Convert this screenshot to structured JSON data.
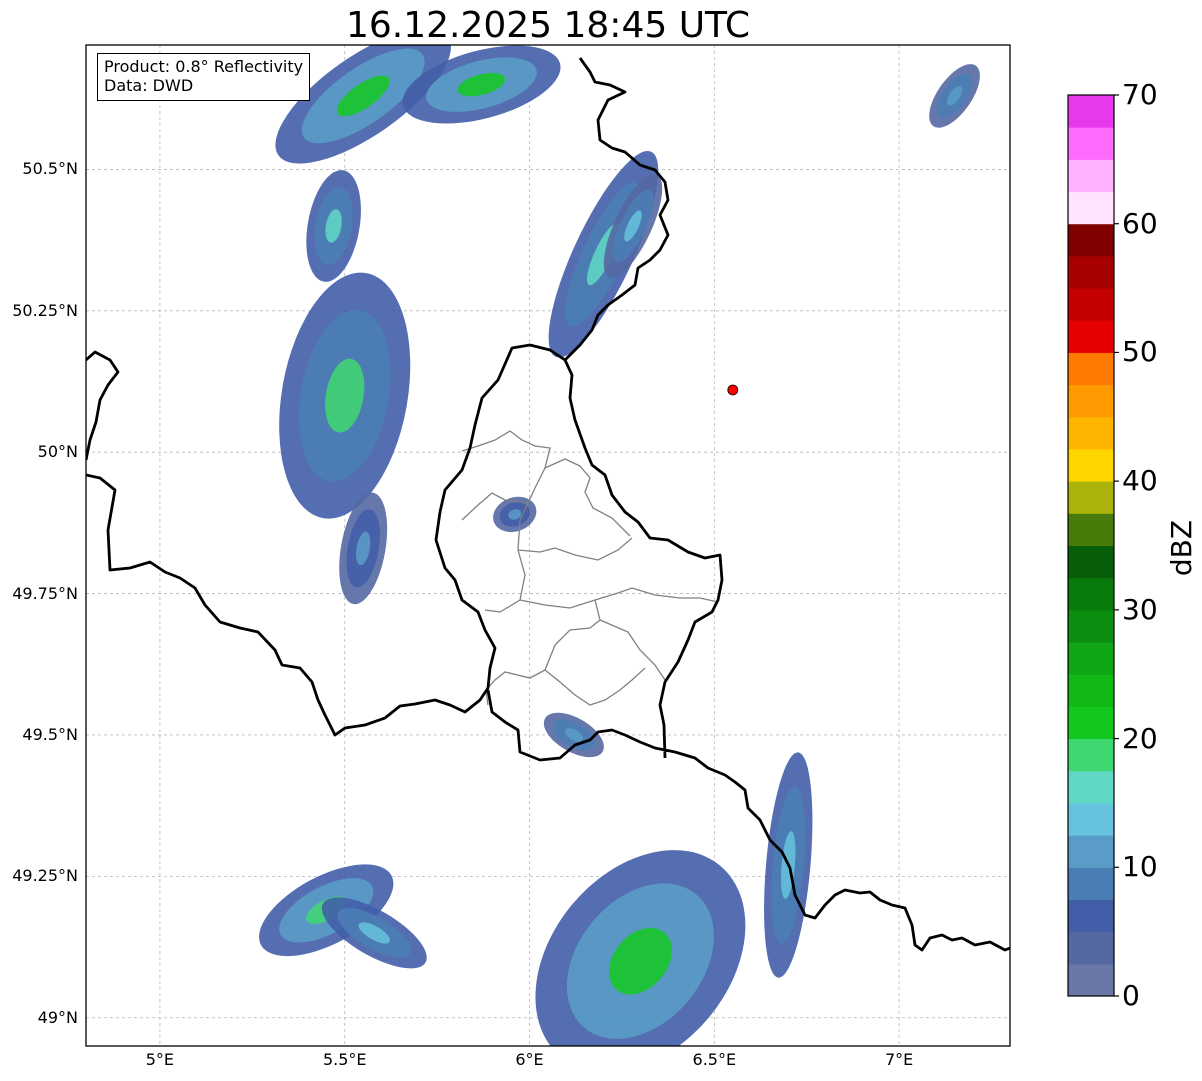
{
  "title": "16.12.2025 18:45 UTC",
  "legend": {
    "product": "Product: 0.8° Reflectivity",
    "source": "Data: DWD"
  },
  "map": {
    "lon_range": [
      4.8,
      7.3
    ],
    "lat_range": [
      48.95,
      50.72
    ],
    "lon_ticks": [
      {
        "value": 5.0,
        "label": "5°E"
      },
      {
        "value": 5.5,
        "label": "5.5°E"
      },
      {
        "value": 6.0,
        "label": "6°E"
      },
      {
        "value": 6.5,
        "label": "6.5°E"
      },
      {
        "value": 7.0,
        "label": "7°E"
      }
    ],
    "lat_ticks": [
      {
        "value": 49.0,
        "label": "49°N"
      },
      {
        "value": 49.25,
        "label": "49.25°N"
      },
      {
        "value": 49.5,
        "label": "49.5°N"
      },
      {
        "value": 49.75,
        "label": "49.75°N"
      },
      {
        "value": 50.0,
        "label": "50°N"
      },
      {
        "value": 50.25,
        "label": "50.25°N"
      },
      {
        "value": 50.5,
        "label": "50.5°N"
      }
    ],
    "gridlines": true,
    "marker": {
      "lon": 6.55,
      "lat": 50.11,
      "color": "#ff0000"
    }
  },
  "colorbar": {
    "label": "dBZ",
    "min": 0,
    "max": 70,
    "step": 5,
    "tick_values": [
      0,
      10,
      20,
      30,
      40,
      50,
      60,
      70
    ],
    "tick_labels": [
      "0",
      "10",
      "20",
      "30",
      "40",
      "50",
      "60",
      "70"
    ],
    "colors": [
      "#6a78a8",
      "#5468a2",
      "#425ea8",
      "#4b7db5",
      "#5a9cc8",
      "#66c3dd",
      "#60d9c4",
      "#3fd870",
      "#14c91e",
      "#12b916",
      "#10a514",
      "#0c8e10",
      "#097a0c",
      "#065e08",
      "#477b0a",
      "#aab30a",
      "#ffd600",
      "#ffb400",
      "#ff9a00",
      "#ff7a00",
      "#e60000",
      "#c40000",
      "#a60000",
      "#800000",
      "#ffe3ff",
      "#ffb2ff",
      "#ff6aff",
      "#e838ec"
    ]
  },
  "echo_cells": [
    {
      "lon": 5.55,
      "lat": 50.63,
      "dlon": 0.28,
      "dlat": 0.07,
      "rot": -35,
      "dbz": 12,
      "core": 22
    },
    {
      "lon": 5.87,
      "lat": 50.65,
      "dlon": 0.22,
      "dlat": 0.06,
      "rot": -15,
      "dbz": 10,
      "core": 20
    },
    {
      "lon": 5.47,
      "lat": 50.4,
      "dlon": 0.07,
      "dlat": 0.1,
      "rot": 10,
      "dbz": 9,
      "core": 16
    },
    {
      "lon": 5.5,
      "lat": 50.1,
      "dlon": 0.17,
      "dlat": 0.22,
      "rot": 10,
      "dbz": 9,
      "core": 18
    },
    {
      "lon": 5.55,
      "lat": 49.83,
      "dlon": 0.06,
      "dlat": 0.1,
      "rot": 10,
      "dbz": 7,
      "core": 12
    },
    {
      "lon": 6.2,
      "lat": 50.35,
      "dlon": 0.08,
      "dlat": 0.2,
      "rot": 25,
      "dbz": 9,
      "core": 17
    },
    {
      "lon": 6.28,
      "lat": 50.4,
      "dlon": 0.05,
      "dlat": 0.1,
      "rot": 25,
      "dbz": 8,
      "core": 14
    },
    {
      "lon": 7.15,
      "lat": 50.63,
      "dlon": 0.1,
      "dlat": 0.03,
      "rot": -55,
      "dbz": 8,
      "core": 12
    },
    {
      "lon": 5.45,
      "lat": 49.19,
      "dlon": 0.2,
      "dlat": 0.06,
      "rot": -28,
      "dbz": 10,
      "core": 18
    },
    {
      "lon": 5.58,
      "lat": 49.15,
      "dlon": 0.16,
      "dlat": 0.04,
      "rot": 30,
      "dbz": 9,
      "core": 14
    },
    {
      "lon": 6.12,
      "lat": 49.5,
      "dlon": 0.09,
      "dlat": 0.03,
      "rot": 30,
      "dbz": 8,
      "core": 12
    },
    {
      "lon": 6.3,
      "lat": 49.1,
      "dlon": 0.24,
      "dlat": 0.22,
      "rot": 40,
      "dbz": 12,
      "core": 22
    },
    {
      "lon": 6.7,
      "lat": 49.27,
      "dlon": 0.06,
      "dlat": 0.2,
      "rot": 5,
      "dbz": 9,
      "core": 13
    },
    {
      "lon": 5.96,
      "lat": 49.89,
      "dlon": 0.06,
      "dlat": 0.03,
      "rot": -20,
      "dbz": 7,
      "core": 11
    }
  ]
}
